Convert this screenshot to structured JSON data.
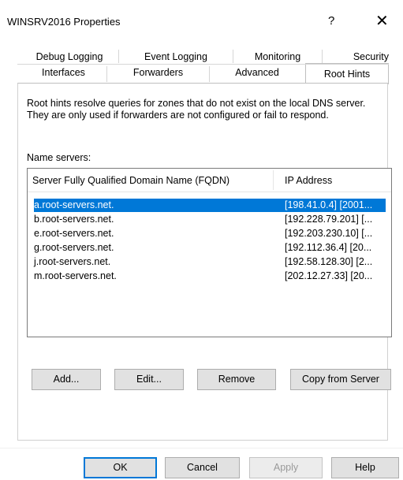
{
  "window": {
    "title": "WINSRV2016 Properties",
    "help_glyph": "?",
    "close_glyph": "✕"
  },
  "tabs": {
    "row1": [
      "Debug Logging",
      "Event Logging",
      "Monitoring",
      "Security"
    ],
    "row2": [
      "Interfaces",
      "Forwarders",
      "Advanced",
      "Root Hints"
    ],
    "active": "Root Hints"
  },
  "panel": {
    "description": "Root hints resolve queries for zones that do not exist on the local DNS server.   They are only used if forwarders are not configured or fail to respond.",
    "name_servers_label": "Name servers:",
    "columns": [
      "Server Fully Qualified Domain Name (FQDN)",
      "IP Address"
    ],
    "rows": [
      {
        "fqdn": "a.root-servers.net.",
        "ip": "[198.41.0.4] [2001...",
        "selected": true
      },
      {
        "fqdn": "b.root-servers.net.",
        "ip": "[192.228.79.201] [...",
        "selected": false
      },
      {
        "fqdn": "e.root-servers.net.",
        "ip": "[192.203.230.10] [...",
        "selected": false
      },
      {
        "fqdn": "g.root-servers.net.",
        "ip": "[192.112.36.4] [20...",
        "selected": false
      },
      {
        "fqdn": "j.root-servers.net.",
        "ip": "[192.58.128.30] [2...",
        "selected": false
      },
      {
        "fqdn": "m.root-servers.net.",
        "ip": "[202.12.27.33] [20...",
        "selected": false
      }
    ],
    "buttons": {
      "add": "Add...",
      "edit": "Edit...",
      "remove": "Remove",
      "copy": "Copy from Server"
    }
  },
  "footer": {
    "ok": "OK",
    "cancel": "Cancel",
    "apply": "Apply",
    "help": "Help"
  }
}
